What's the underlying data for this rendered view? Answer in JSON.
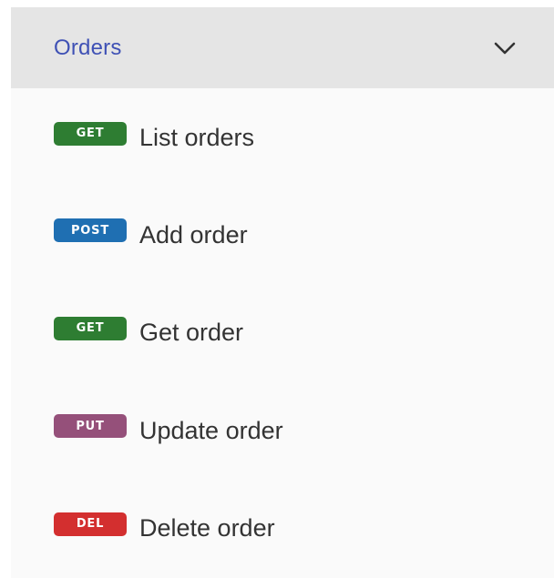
{
  "group": {
    "title": "Orders",
    "expand_icon": "chevron-down-icon"
  },
  "operations": [
    {
      "method": "GET",
      "label": "List orders",
      "color": "#2e7d32"
    },
    {
      "method": "POST",
      "label": "Add order",
      "color": "#1f6fb2"
    },
    {
      "method": "GET",
      "label": "Get order",
      "color": "#2e7d32"
    },
    {
      "method": "PUT",
      "label": "Update order",
      "color": "#95507a"
    },
    {
      "method": "DEL",
      "label": "Delete order",
      "color": "#d32f2f"
    }
  ]
}
